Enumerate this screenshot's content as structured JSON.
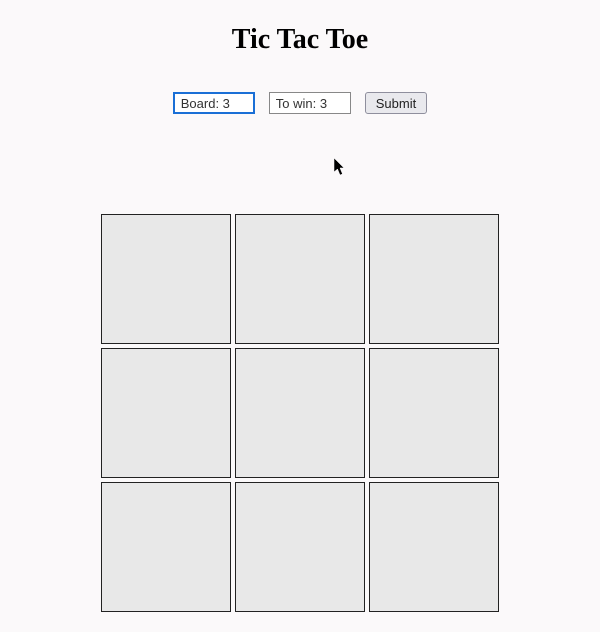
{
  "header": {
    "title": "Tic Tac Toe"
  },
  "controls": {
    "board_input_value": "Board: 3",
    "towin_input_value": "To win: 3",
    "submit_label": "Submit"
  },
  "board": {
    "size": 3,
    "cells": [
      "",
      "",
      "",
      "",
      "",
      "",
      "",
      "",
      ""
    ]
  }
}
